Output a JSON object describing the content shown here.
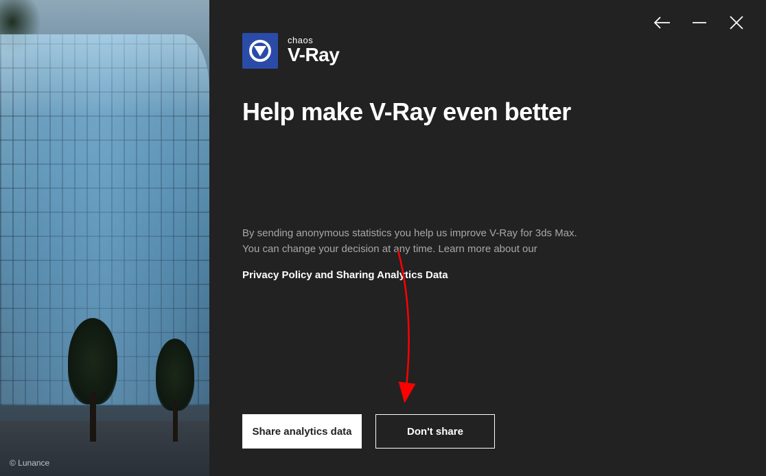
{
  "sidebar": {
    "credit": "© Lunance"
  },
  "logo": {
    "brand_small": "chaos",
    "brand_large": "V-Ray"
  },
  "header": {
    "title": "Help make V-Ray even better"
  },
  "body": {
    "description_line1": "By sending anonymous statistics you help us improve V-Ray for 3ds Max.",
    "description_line2": "You can change your decision at any time. Learn more about our",
    "privacy_link": "Privacy Policy and Sharing Analytics Data"
  },
  "buttons": {
    "primary": "Share analytics data",
    "secondary": "Don't share"
  }
}
